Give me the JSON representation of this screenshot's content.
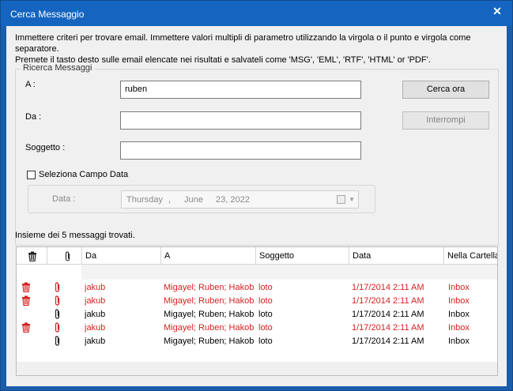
{
  "window": {
    "title": "Cerca Messaggio",
    "close_glyph": "✕"
  },
  "instructions": {
    "line1": "Immettere criteri per trovare email. Immettere valori multipli di parametro utilizzando la virgola o il punto e virgola come separatore.",
    "line2": "Premete il tasto desto sulle email elencate nei risultati e salvateli come  'MSG', 'EML', 'RTF', 'HTML' or 'PDF'."
  },
  "search_group": {
    "legend": "Ricerca Messaggi",
    "to_label": "A :",
    "to_value": "ruben",
    "from_label": "Da :",
    "from_value": "",
    "subject_label": "Soggetto :",
    "subject_value": "",
    "search_button": "Cerca ora",
    "stop_button": "Interrompi",
    "date_checkbox_label": "Seleziona Campo Data",
    "date_checkbox_checked": false,
    "date_label": "Data :",
    "date_weekday": "Thursday",
    "date_sep": ",",
    "date_month": "June",
    "date_day_year": "23, 2022"
  },
  "status": "Insieme dei 5 messaggi trovati.",
  "grid": {
    "columns": [
      "Da",
      "A",
      "Soggetto",
      "Data",
      "Nella Cartella"
    ],
    "rows": [
      {
        "deleted": true,
        "attachment": true,
        "red": true,
        "from": "jakub",
        "to": "Migayel; Ruben; Hakob",
        "subject": "loto",
        "date": "1/17/2014 2:11 AM",
        "folder": "Inbox"
      },
      {
        "deleted": true,
        "attachment": true,
        "red": true,
        "from": "jakub",
        "to": "Migayel; Ruben; Hakob",
        "subject": "loto",
        "date": "1/17/2014 2:11 AM",
        "folder": "Inbox"
      },
      {
        "deleted": false,
        "attachment": true,
        "red": false,
        "from": "jakub",
        "to": "Migayel; Ruben; Hakob",
        "subject": "loto",
        "date": "1/17/2014 2:11 AM",
        "folder": "Inbox"
      },
      {
        "deleted": true,
        "attachment": true,
        "red": true,
        "from": "jakub",
        "to": "Migayel; Ruben; Hakob",
        "subject": "loto",
        "date": "1/17/2014 2:11 AM",
        "folder": "Inbox"
      },
      {
        "deleted": false,
        "attachment": true,
        "red": false,
        "from": "jakub",
        "to": "Migayel; Ruben; Hakob",
        "subject": "loto",
        "date": "1/17/2014 2:11 AM",
        "folder": "Inbox"
      }
    ],
    "deleted_color": "#d81f1f"
  }
}
